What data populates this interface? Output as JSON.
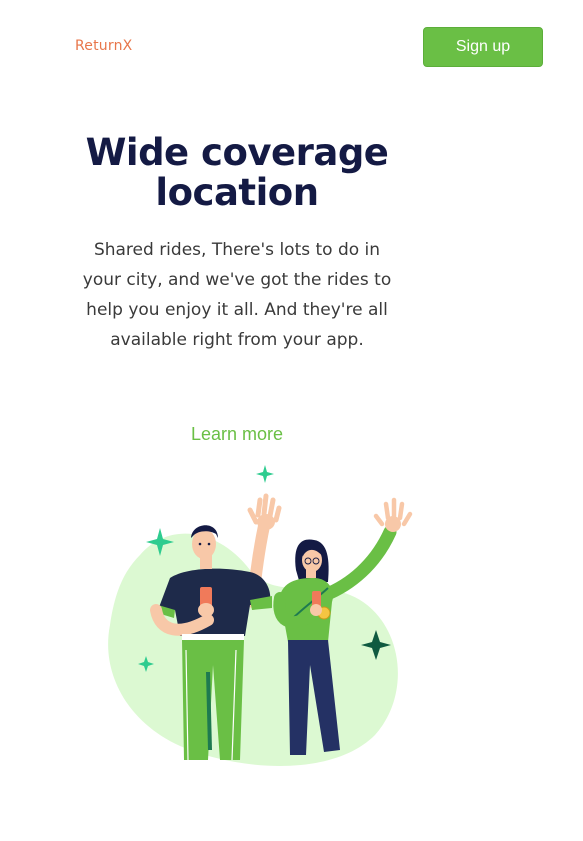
{
  "header": {
    "logo_text": "ReturnX",
    "signup_label": "Sign up"
  },
  "hero": {
    "title": "Wide coverage location",
    "description": "Shared rides, There's lots to do in your city, and we've got the rides to help you enjoy it all. And they're all available right from your app.",
    "link_label": "Learn more"
  },
  "colors": {
    "accent": "#6abf45",
    "logo": "#e8764a",
    "heading": "#141a44",
    "blob": "#dcf9d2",
    "sparkle_light": "#2ecc8f",
    "sparkle_dark": "#0f5a40"
  },
  "illustration": {
    "icon": "two-people-waving-illustration"
  }
}
